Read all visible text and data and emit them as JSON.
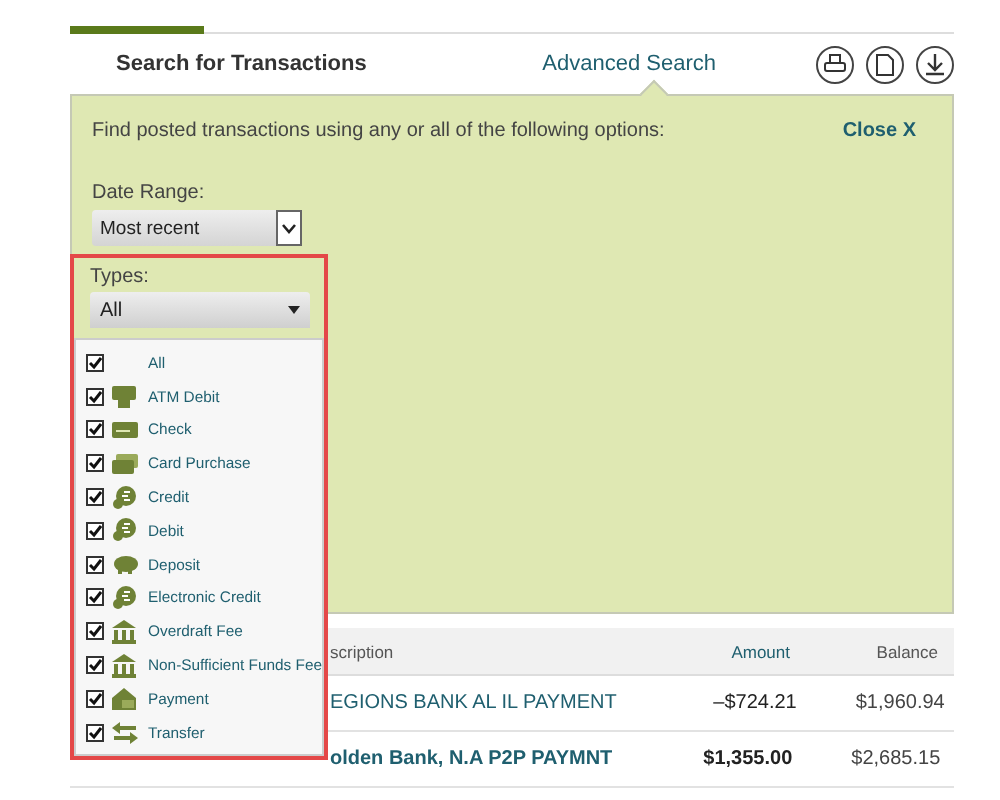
{
  "header": {
    "title": "Search for Transactions",
    "link": "Advanced Search"
  },
  "search_panel": {
    "intro": "Find posted transactions using any or all of the following options:",
    "close": "Close X",
    "date_range": {
      "label": "Date Range:",
      "value": "Most recent"
    },
    "types": {
      "label": "Types:",
      "value": "All",
      "expanded": true,
      "options": [
        {
          "label": "All",
          "kind": "none",
          "checked": true
        },
        {
          "label": "ATM Debit",
          "kind": "atm",
          "checked": true
        },
        {
          "label": "Check",
          "kind": "check",
          "checked": true
        },
        {
          "label": "Card Purchase",
          "kind": "card",
          "checked": true
        },
        {
          "label": "Credit",
          "kind": "coin",
          "checked": true
        },
        {
          "label": "Debit",
          "kind": "coin",
          "checked": true
        },
        {
          "label": "Deposit",
          "kind": "piggy",
          "checked": true
        },
        {
          "label": "Electronic Credit",
          "kind": "coin",
          "checked": true
        },
        {
          "label": "Overdraft Fee",
          "kind": "bank",
          "checked": true
        },
        {
          "label": "Non-Sufficient Funds Fee",
          "kind": "bank",
          "checked": true
        },
        {
          "label": "Payment",
          "kind": "payment",
          "checked": true
        },
        {
          "label": "Transfer",
          "kind": "transfer",
          "checked": true
        }
      ]
    }
  },
  "table": {
    "columns": [
      "scription",
      "Amount",
      "Balance"
    ],
    "rows": [
      {
        "description": "EGIONS BANK AL IL PAYMENT",
        "amount": "–$724.21",
        "balance": "$1,960.94",
        "bold": false
      },
      {
        "description": "olden Bank, N.A P2P PAYMNT",
        "amount": "$1,355.00",
        "balance": "$2,685.15",
        "bold": true
      }
    ]
  }
}
